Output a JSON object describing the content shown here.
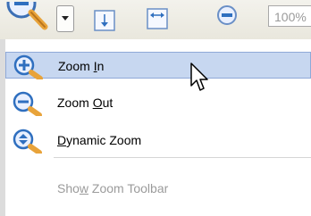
{
  "toolbar": {
    "zoom_field_value": "100%",
    "icons": [
      "zoom-dropdown-icon",
      "fit-page-icon",
      "fit-width-icon",
      "zoom-out-small-icon"
    ]
  },
  "menu": {
    "items": [
      {
        "pre": "Zoom ",
        "mnemonic": "I",
        "post": "n",
        "icon": "zoom-in-icon",
        "selected": true,
        "enabled": true
      },
      {
        "pre": "Zoom ",
        "mnemonic": "O",
        "post": "ut",
        "icon": "zoom-out-icon",
        "selected": false,
        "enabled": true
      },
      {
        "pre": "",
        "mnemonic": "D",
        "post": "ynamic Zoom",
        "icon": "dynamic-zoom-icon",
        "selected": false,
        "enabled": true
      },
      {
        "pre": "Sho",
        "mnemonic": "w",
        "post": " Zoom Toolbar",
        "icon": "",
        "selected": false,
        "enabled": false
      }
    ]
  },
  "colors": {
    "selection": "#c7d7f0",
    "selection_border": "#8fa9d8",
    "icon_blue": "#2f6fbf",
    "disabled_text": "#9b9b9b"
  }
}
